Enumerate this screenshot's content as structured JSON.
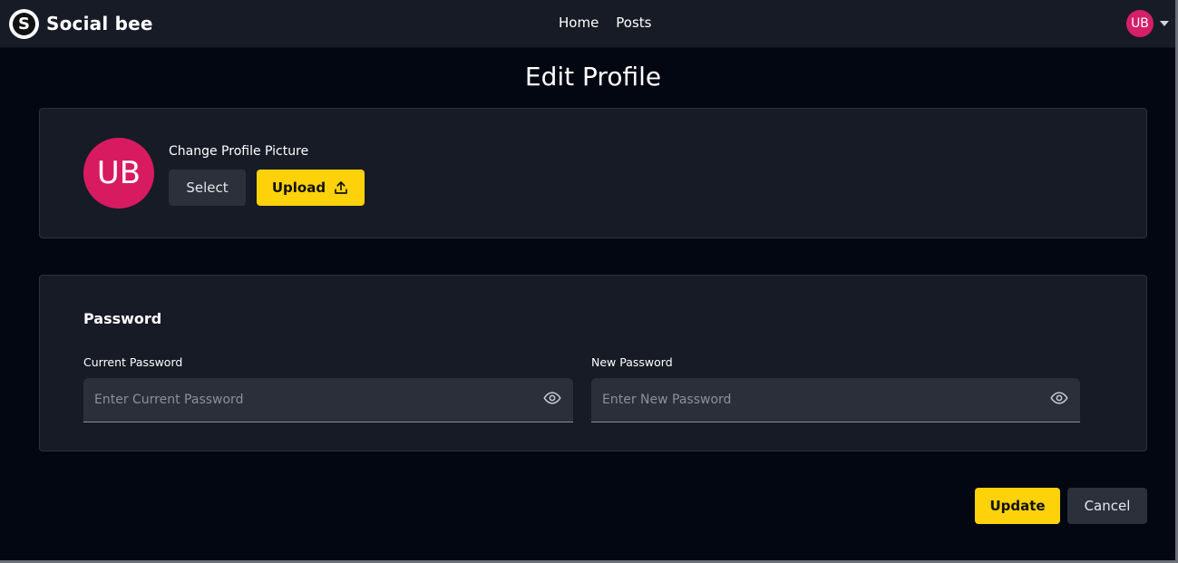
{
  "navbar": {
    "brand_initial": "S",
    "brand_name": "Social bee",
    "links": [
      {
        "label": "Home"
      },
      {
        "label": "Posts"
      }
    ],
    "user_initials": "UB"
  },
  "page": {
    "title": "Edit Profile"
  },
  "profile_picture": {
    "avatar_initials": "UB",
    "avatar_color": "#d81b60",
    "label": "Change Profile Picture",
    "select_label": "Select",
    "upload_label": "Upload",
    "upload_icon": "upload-icon"
  },
  "password": {
    "section_title": "Password",
    "current": {
      "label": "Current Password",
      "placeholder": "Enter Current Password",
      "value": "",
      "icon": "eye-icon"
    },
    "new": {
      "label": "New Password",
      "placeholder": "Enter New Password",
      "value": "",
      "icon": "eye-icon"
    }
  },
  "actions": {
    "update_label": "Update",
    "cancel_label": "Cancel"
  },
  "colors": {
    "accent": "#fdd20a",
    "avatar": "#d61f69",
    "background": "#020712",
    "card": "#171b26"
  }
}
